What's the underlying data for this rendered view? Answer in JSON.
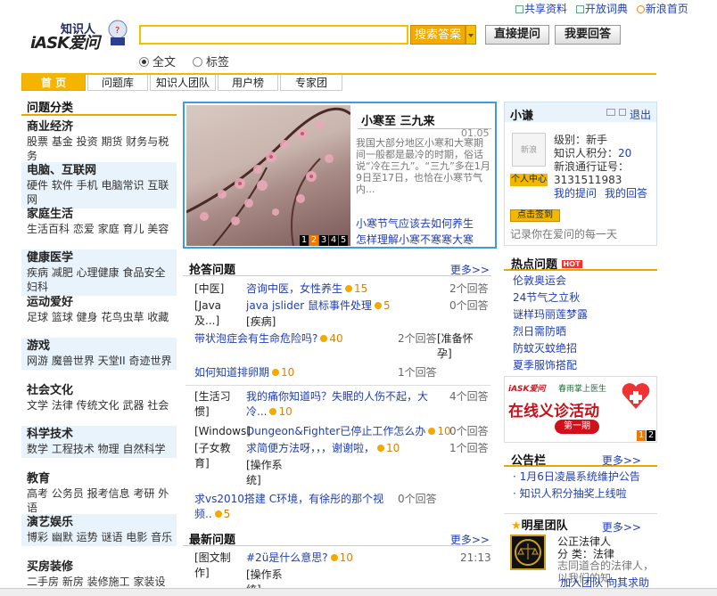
{
  "top_links": [
    "共享资料",
    "开放词典",
    "新浪首页"
  ],
  "logo": {
    "text_top": "知识人",
    "text_bottom": "iASK爱问"
  },
  "search": {
    "value": "",
    "button": "搜索答案",
    "ask_button": "直接提问",
    "answer_button": "我要回答"
  },
  "search_scope": {
    "fulltext": "全文",
    "tags": "标签",
    "selected": "全文"
  },
  "nav": [
    "首 页",
    "问题库",
    "知识人团队",
    "用户榜",
    "专家团"
  ],
  "categories_title": "问题分类",
  "categories": [
    {
      "title": "商业经济",
      "items": "股票 基金 投资 期货 财务与税务"
    },
    {
      "title": "电脑、互联网",
      "items": "硬件 软件 手机 电脑常识 互联网"
    },
    {
      "title": "家庭生活",
      "items": "生活百科 恋爱 家庭 育儿 美容"
    },
    {
      "title": "健康医学",
      "items": "疾病 减肥 心理健康 食品安全 妇科"
    },
    {
      "title": "运动爱好",
      "items": "足球 篮球 健身 花鸟虫草 收藏"
    },
    {
      "title": "游戏",
      "items": "网游 魔兽世界 天堂II 奇迹世界"
    },
    {
      "title": "社会文化",
      "items": "文学 法律 传统文化 武器 社会"
    },
    {
      "title": "科学技术",
      "items": "数学 工程技术 物理 自然科学"
    },
    {
      "title": "教育",
      "items": "高考 公务员 报考信息 考研 外语"
    },
    {
      "title": "演艺娱乐",
      "items": "博彩 幽默 运势 谜语 电影 音乐"
    },
    {
      "title": "买房装修",
      "items": "二手房 新房 装修施工 家装设"
    }
  ],
  "featured": {
    "title": "小寒至 三九来",
    "date": "01.05",
    "text": "我国大部分地区小寒和大寒期间一般都是最冷的时期，俗话说“冷在三九”。“三九”多在1月9日至17日，也恰在小寒节气内...",
    "links": [
      "小寒节气应该去如何养生",
      "怎样理解小寒不寒寒大寒"
    ],
    "pager": [
      "1",
      "2",
      "3",
      "4",
      "5"
    ],
    "pager_active": 1
  },
  "rush": {
    "title": "抢答问题",
    "more": "更多>>",
    "group1": [
      {
        "cat": "[中医]",
        "q": "咨询中医，女性养生",
        "pts": "15",
        "ans": "2个回答"
      },
      {
        "cat": "[Java及...]",
        "q": "java jslider 鼠标事件处理",
        "pts": "5",
        "ans": "0个回答"
      },
      {
        "cat": "[疾病]",
        "q": "带状泡症会有生命危险吗?",
        "pts": "40",
        "ans": "2个回答"
      },
      {
        "cat": "[准备怀孕]",
        "q": "如何知道排卵期",
        "pts": "10",
        "ans": "1个回答"
      }
    ],
    "group2": [
      {
        "cat": "[生活习惯]",
        "q": "我的痛你知道吗？失眠的人伤不起，大冷...",
        "pts": "10",
        "ans": "4个回答"
      },
      {
        "cat": "[Windows]",
        "q": "Dungeon&Fighter已停止工作怎么办",
        "pts": "10",
        "ans": "0个回答"
      },
      {
        "cat": "[子女教育]",
        "q": "求简便方法呀，，，谢谢啦，",
        "pts": "10",
        "ans": "1个回答"
      },
      {
        "cat": "[操作系统]",
        "q": "求vs2010搭建 C环境，有徐彤的那个视频..",
        "pts": "5",
        "ans": "0个回答"
      }
    ]
  },
  "latest": {
    "title": "最新问题",
    "more": "更多>>",
    "items": [
      {
        "cat": "[图文制作]",
        "q": "#2ü是什么意思?",
        "pts": "10",
        "time": "21:13"
      },
      {
        "cat": "[操作系统]",
        "q": "",
        "pts": "",
        "time": ""
      }
    ]
  },
  "user": {
    "name": "小谦",
    "logout": "退出",
    "avatar_label": "新浪 iASK",
    "center": "个人中心",
    "level": "级别：新手",
    "points_label": "知识人积分：",
    "points": "20",
    "id_label": "新浪通行证号：",
    "id": "3131511983",
    "my_questions": "我的提问",
    "my_answers": "我的回答",
    "checkin": "点击签到",
    "slogan": "记录你在爱问的每一天"
  },
  "hot": {
    "title": "热点问题",
    "badge": "HOT",
    "items": [
      "伦敦奥运会",
      "24节气之立秋",
      "谜样玛丽莲梦露",
      "烈日需防晒",
      "防蚊灭蚊绝招",
      "夏季服饰搭配"
    ]
  },
  "ad": {
    "brand": "iASK爱问",
    "partner": "春雨掌上医生",
    "headline": "在线义诊活动",
    "sub": "第一期",
    "pager": [
      "1",
      "2"
    ]
  },
  "notice": {
    "title": "公告栏",
    "more": "更多>>",
    "items": [
      "1月6日凌晨系统维护公告",
      "知识人积分抽奖上线啦"
    ]
  },
  "star": {
    "title": "明星团队",
    "more": "更多>>",
    "team": "公正法律人",
    "cat": "分 类：法律",
    "desc": "志同道合的法律人，以我们的知...",
    "join": "加入团队",
    "ask": "向其求助"
  },
  "colors": {
    "accent": "#f2b800",
    "link": "#1f3fb0",
    "featured_border": "#3f9be0"
  }
}
